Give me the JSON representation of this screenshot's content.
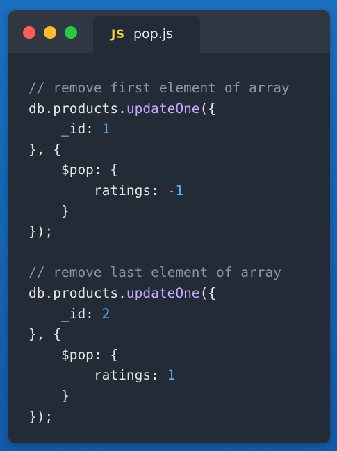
{
  "colors": {
    "background": "#1565b5",
    "editor": "#222b36",
    "titlebar": "#2e3742",
    "close": "#ff5f57",
    "minimize": "#febc2e",
    "maximize": "#28c840",
    "js_badge": "#f0d23a",
    "comment": "#8b95a3",
    "function": "#c7a6ff",
    "number": "#4fb5ff",
    "negative_sign": "#ff6b5b"
  },
  "tab": {
    "icon_text": "JS",
    "file_name": "pop.js"
  },
  "code": {
    "line1": "// remove first element of array",
    "line2_obj": "db.products.",
    "line2_fn": "updateOne",
    "line2_rest": "({",
    "line3_key": "    _id: ",
    "line3_val": "1",
    "line4": "}, {",
    "line5": "    $pop: {",
    "line6_key": "        ratings: ",
    "line6_sign": "-",
    "line6_val": "1",
    "line7": "    }",
    "line8": "});",
    "line10": "// remove last element of array",
    "line11_obj": "db.products.",
    "line11_fn": "updateOne",
    "line11_rest": "({",
    "line12_key": "    _id: ",
    "line12_val": "2",
    "line13": "}, {",
    "line14": "    $pop: {",
    "line15_key": "        ratings: ",
    "line15_val": "1",
    "line16": "    }",
    "line17": "});"
  }
}
